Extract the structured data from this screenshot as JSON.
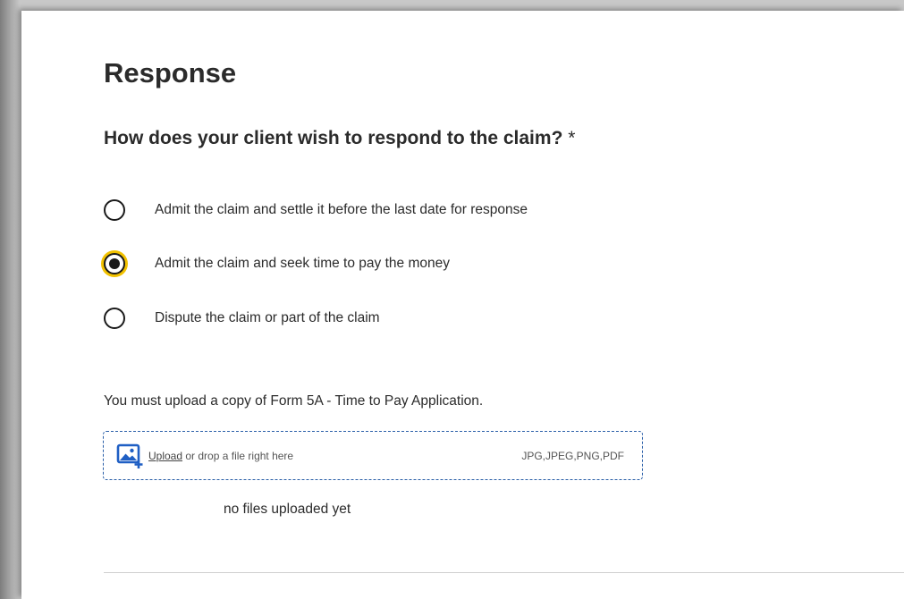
{
  "form": {
    "title": "Response",
    "question": "How does your client wish to respond to the claim?",
    "required_marker": "*",
    "options": [
      {
        "label": "Admit the claim and settle it before the last date for response",
        "selected": false
      },
      {
        "label": "Admit the claim and seek time to pay the money",
        "selected": true
      },
      {
        "label": "Dispute the claim or part of the claim",
        "selected": false
      }
    ],
    "instruction": "You must upload a copy of Form 5A - Time to Pay Application.",
    "upload": {
      "link_label": "Upload",
      "hint": " or drop a file right here",
      "file_types": "JPG,JPEG,PNG,PDF",
      "icon": "image-upload-icon",
      "status": "no files uploaded yet"
    }
  },
  "colors": {
    "accent_blue": "#2a5fa8",
    "focus_ring": "#f2c200",
    "text": "#2b2b2b"
  }
}
